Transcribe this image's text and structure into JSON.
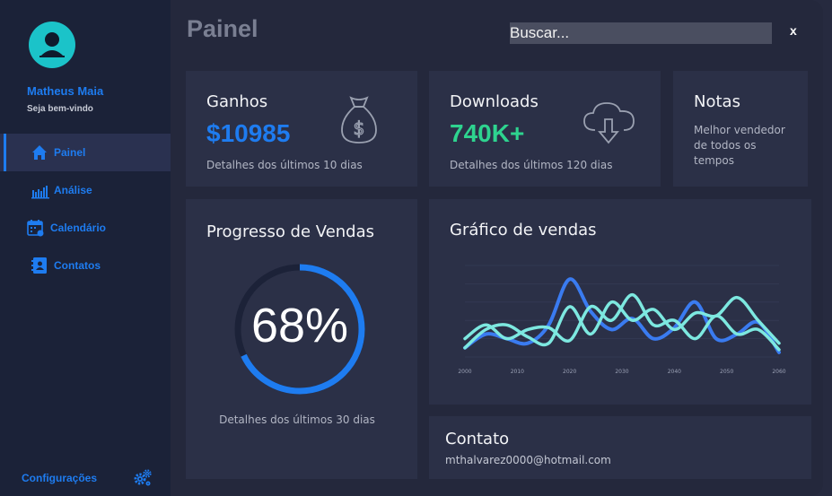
{
  "sidebar": {
    "username": "Matheus Maia",
    "welcome": "Seja bem-vindo",
    "items": [
      {
        "label": "Painel",
        "icon": "home-icon",
        "active": true
      },
      {
        "label": "Análise",
        "icon": "bar-chart-icon",
        "active": false
      },
      {
        "label": "Calendário",
        "icon": "calendar-icon",
        "active": false
      },
      {
        "label": "Contatos",
        "icon": "contact-book-icon",
        "active": false
      }
    ],
    "settings_label": "Configurações",
    "settings_icon": "gears-icon"
  },
  "header": {
    "title": "Painel",
    "search_placeholder": "Buscar...",
    "close_label": "x"
  },
  "cards": {
    "ganhos": {
      "title": "Ganhos",
      "value": "$10985",
      "desc": "Detalhes dos últimos 10 dias",
      "icon": "money-bag-icon"
    },
    "downloads": {
      "title": "Downloads",
      "value": "740K+",
      "desc": "Detalhes dos últimos 120 dias",
      "icon": "cloud-download-icon"
    },
    "notas": {
      "title": "Notas",
      "desc": "Melhor vendedor de todos os tempos"
    },
    "progresso": {
      "title": "Progresso de Vendas",
      "value_text": "68%",
      "value": 0.68,
      "desc": "Detalhes dos últimos 30 dias"
    },
    "grafico": {
      "title": "Gráfico de vendas"
    },
    "contato": {
      "title": "Contato",
      "email": "mthalvarez0000@hotmail.com"
    }
  },
  "colors": {
    "accent": "#1e7cf0",
    "teal": "#2ed38f",
    "line_blue": "#3a7bf0",
    "line_cyan": "#7de8e0"
  },
  "chart_data": {
    "type": "line",
    "x_ticks": [
      "2000",
      "2010",
      "2020",
      "2030",
      "2040",
      "2050",
      "2060"
    ],
    "xlim": [
      2000,
      2060
    ],
    "ylim": [
      0,
      10
    ],
    "grid": true,
    "series": [
      {
        "x": [
          2000,
          2004,
          2008,
          2012,
          2016,
          2020,
          2024,
          2028,
          2032,
          2036,
          2040,
          2044,
          2048,
          2052,
          2056,
          2060
        ],
        "y": [
          1.0,
          2.5,
          2.0,
          1.5,
          3.5,
          8.5,
          5.0,
          3.0,
          4.2,
          2.0,
          3.2,
          6.0,
          2.0,
          2.5,
          3.8,
          0.5
        ]
      },
      {
        "x": [
          2000,
          2004,
          2008,
          2012,
          2016,
          2020,
          2024,
          2028,
          2032,
          2036,
          2040,
          2044,
          2048,
          2052,
          2056,
          2060
        ],
        "y": [
          2.0,
          3.5,
          2.0,
          3.0,
          3.2,
          1.8,
          5.5,
          4.0,
          6.8,
          3.5,
          4.0,
          2.0,
          4.5,
          2.5,
          3.0,
          0.8
        ]
      },
      {
        "x": [
          2000,
          2004,
          2008,
          2012,
          2016,
          2020,
          2024,
          2028,
          2032,
          2036,
          2040,
          2044,
          2048,
          2052,
          2056,
          2060
        ],
        "y": [
          1.0,
          3.0,
          3.5,
          2.2,
          1.5,
          5.5,
          2.5,
          6.0,
          4.0,
          5.2,
          3.0,
          4.8,
          4.5,
          6.5,
          4.0,
          1.5
        ]
      }
    ]
  }
}
